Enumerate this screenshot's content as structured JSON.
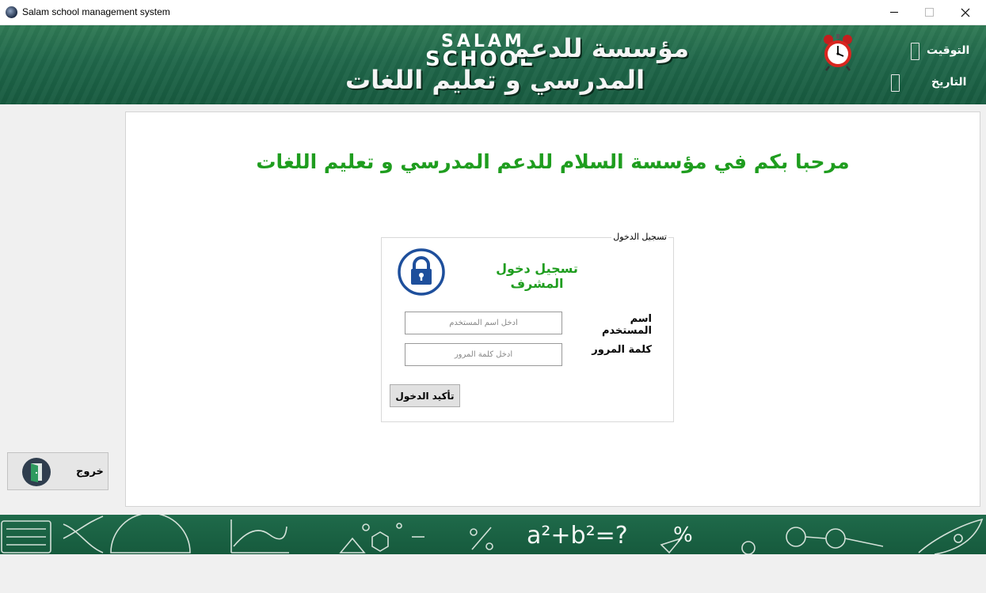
{
  "window": {
    "title": "Salam school management system"
  },
  "header": {
    "logo_top": "SALAM",
    "logo_bottom": "SCHOOL",
    "line1": "مؤسسة للدعم",
    "line2": "المدرسي و تعليم اللغات",
    "time_label": "التوقيت",
    "date_label": "التاريخ",
    "time_value": "",
    "date_value": ""
  },
  "main": {
    "welcome": "مرحبا بكم في مؤسسة السلام للدعم المدرسي و تعليم اللغات"
  },
  "login": {
    "group_title": "تسجيل الدخول",
    "heading": "تسجيل دخول المشرف",
    "username_label": "اسم المستخدم",
    "username_placeholder": "أدخل اسم المستخدم",
    "password_label": "كلمة المرور",
    "password_placeholder": "أدخل كلمة المرور",
    "confirm_label": "تأكيد الدخول"
  },
  "sidebar": {
    "exit_label": "خروج"
  },
  "footer": {
    "formula": "a²+b²=?"
  },
  "colors": {
    "accent_green": "#1f9d1f",
    "banner_green": "#20674a",
    "lock_blue": "#1e4f9c"
  },
  "icons": {
    "app": "app-icon",
    "clock": "alarm-clock-icon",
    "lock": "lock-icon",
    "exit": "exit-door-icon"
  }
}
